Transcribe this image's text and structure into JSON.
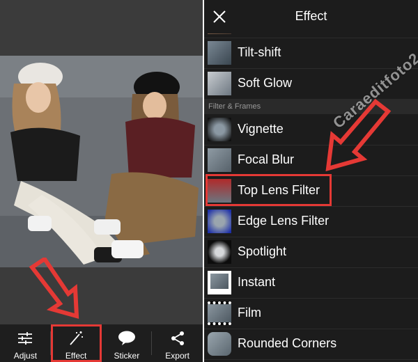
{
  "app": {
    "accent_highlight": "#e53935"
  },
  "effect_panel": {
    "title": "Effect",
    "section_label": "Filter & Frames",
    "items": [
      {
        "label": "Tilt-shift"
      },
      {
        "label": "Soft Glow"
      },
      {
        "label": "Vignette"
      },
      {
        "label": "Focal Blur"
      },
      {
        "label": "Top Lens Filter"
      },
      {
        "label": "Edge Lens Filter"
      },
      {
        "label": "Spotlight"
      },
      {
        "label": "Instant"
      },
      {
        "label": "Film"
      },
      {
        "label": "Rounded Corners"
      }
    ]
  },
  "toolbar": {
    "adjust_label": "Adjust",
    "effect_label": "Effect",
    "sticker_label": "Sticker",
    "export_label": "Export"
  },
  "watermark": "Caraeditfoto2"
}
